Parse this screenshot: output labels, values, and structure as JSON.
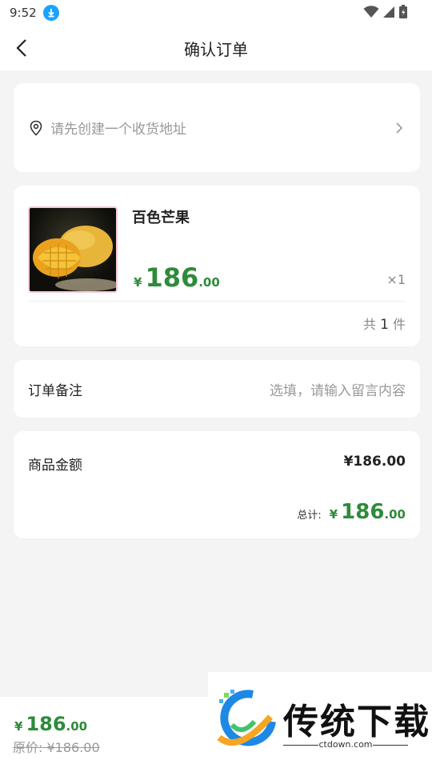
{
  "status_bar": {
    "time": "9:52"
  },
  "header": {
    "title": "确认订单"
  },
  "address": {
    "placeholder": "请先创建一个收货地址"
  },
  "product": {
    "name": "百色芒果",
    "currency": "¥",
    "price_int": "186",
    "price_dec": ".00",
    "quantity": "×1",
    "count_prefix": "共",
    "count": "1",
    "count_suffix": "件"
  },
  "remark": {
    "label": "订单备注",
    "placeholder": "选填，请输入留言内容"
  },
  "summary": {
    "goods_label": "商品金额",
    "goods_amount": "¥186.00",
    "total_label": "总计:",
    "currency": "¥",
    "total_int": "186",
    "total_dec": ".00"
  },
  "bottom_bar": {
    "currency": "¥",
    "price_int": "186",
    "price_dec": ".00",
    "original_price": "原价: ¥186.00"
  },
  "watermark": {
    "brand": "传统下载",
    "url": "ctdown.com"
  },
  "colors": {
    "accent_green": "#2e8b3a",
    "download_blue": "#1aa3ff"
  }
}
